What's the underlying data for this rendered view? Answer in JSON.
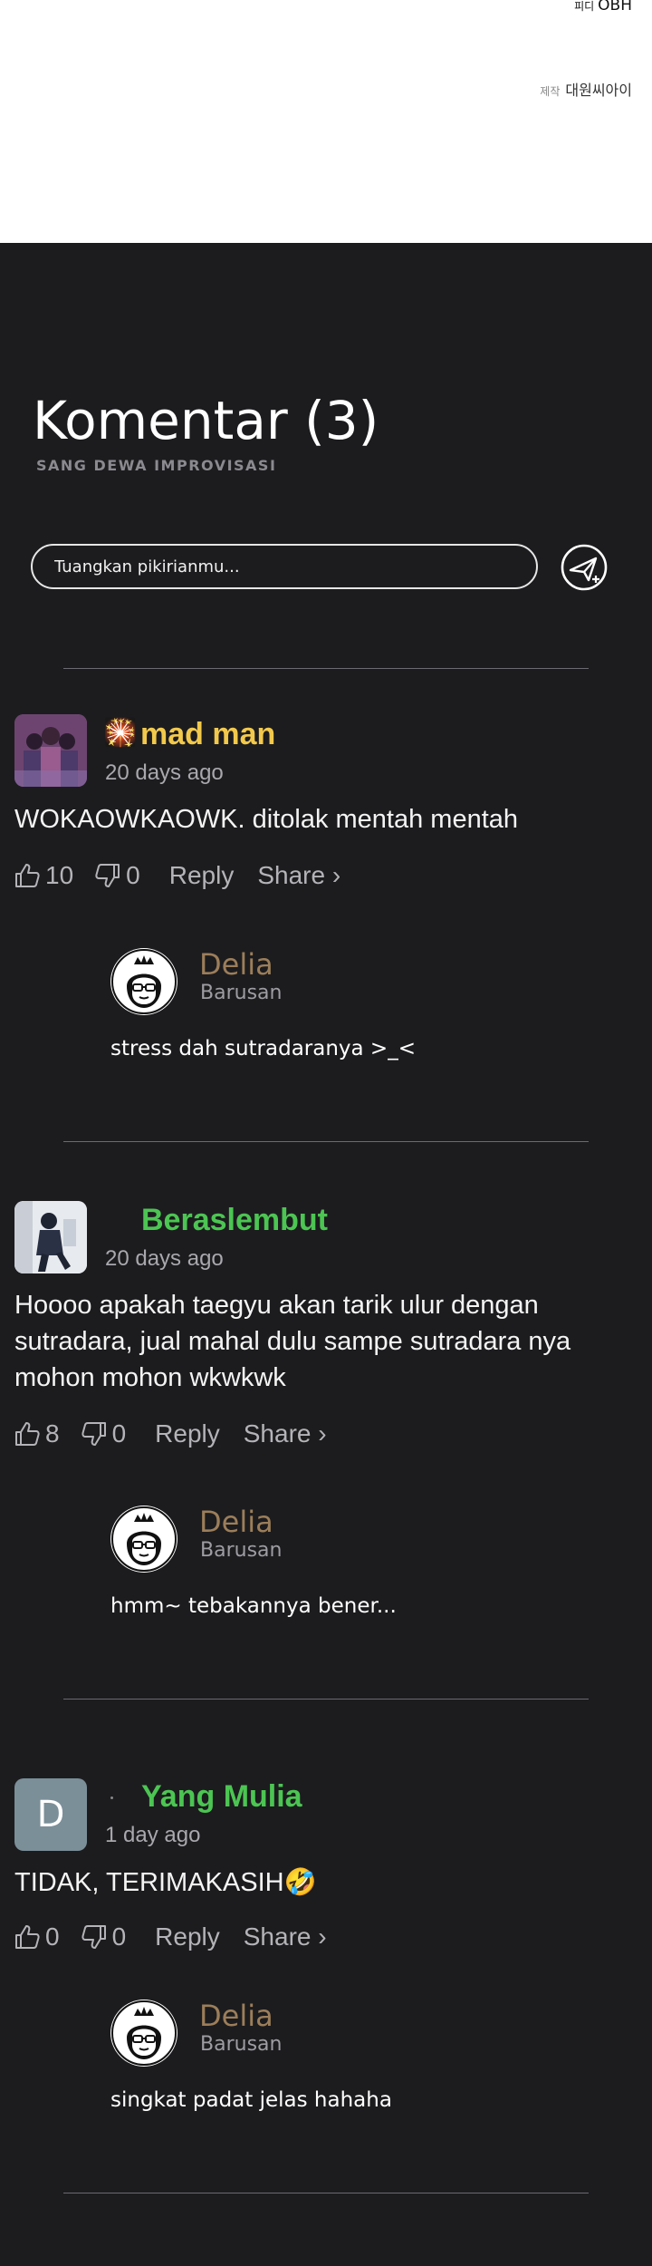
{
  "credits": {
    "line1_prefix": "피디",
    "line1_value": "OBH",
    "line2_prefix": "제작",
    "line2_value": "대원씨아이"
  },
  "section": {
    "title": "Komentar (3)",
    "subtitle": "SANG DEWA IMPROVISASI"
  },
  "input": {
    "placeholder": "Tuangkan pikirianmu..."
  },
  "comments": [
    {
      "badge": "🎇",
      "username": "mad man",
      "username_color": "#f2c94c",
      "time": "20 days ago",
      "text": "WOKAOWKAOWK. ditolak mentah mentah",
      "likes": "10",
      "dislikes": "0",
      "reply_label": "Reply",
      "share_label": "Share ›",
      "reply": {
        "name": "Delia",
        "time": "Barusan",
        "text": "stress dah sutradaranya >_<"
      }
    },
    {
      "username": "Beraslembut",
      "username_color": "#4cc552",
      "time": "20 days ago",
      "text": "Hoooo apakah taegyu akan tarik ulur dengan sutradara, jual mahal dulu sampe sutradara nya mohon mohon wkwkwk",
      "likes": "8",
      "dislikes": "0",
      "reply_label": "Reply",
      "share_label": "Share ›",
      "reply": {
        "name": "Delia",
        "time": "Barusan",
        "text": "hmm~ tebakannya bener..."
      }
    },
    {
      "avatar_letter": "D",
      "username": "Yang Mulia",
      "username_color": "#4cc552",
      "time": "1 day ago",
      "text": "TIDAK, TERIMAKASIH🤣",
      "likes": "0",
      "dislikes": "0",
      "reply_label": "Reply",
      "share_label": "Share ›",
      "reply": {
        "name": "Delia",
        "time": "Barusan",
        "text": "singkat padat jelas hahaha"
      }
    }
  ],
  "colors": {
    "background": "#1c1c1f",
    "reply_name": "#9c7e5a",
    "muted": "#a8a8ad"
  }
}
